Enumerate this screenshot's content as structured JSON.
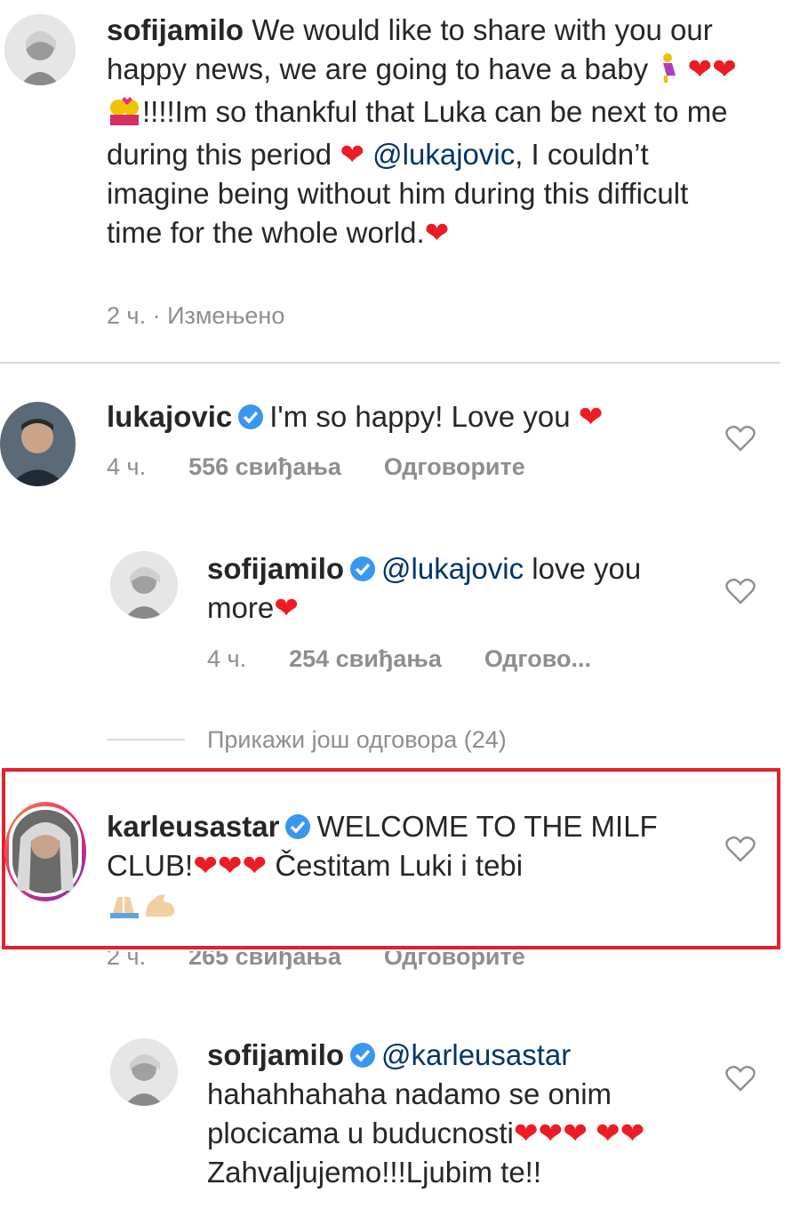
{
  "post": {
    "username": "sofijamilo",
    "caption_part1": "We would like to share with you our happy news, we are going to have a baby",
    "caption_part2": "!!!!Im so thankful that Luka can be next to me during this period",
    "caption_mention": "@lukajovic",
    "caption_part3": ", I couldn’t  imagine being without him during this difficult time for the whole world.",
    "time": "2 ч.",
    "edited": " · Измењено"
  },
  "comments": [
    {
      "username": "lukajovic",
      "text": "I'm so happy! Love you",
      "time": "4 ч.",
      "likes": "556 свиђања",
      "reply": "Одговорите"
    },
    {
      "username": "sofijamilo",
      "mention": "@lukajovic",
      "text": " love you more",
      "time": "4 ч.",
      "likes": "254 свиђања",
      "reply": "Одгово..."
    },
    {
      "username": "karleusastar",
      "text1": "WELCOME TO THE MILF CLUB!",
      "text2": " Čestitam Luki i tebi",
      "time": "2 ч.",
      "likes": "265 свиђања",
      "reply": "Одговорите"
    },
    {
      "username": "sofijamilo",
      "mention": "@karleusastar",
      "text1": " hahahhahaha nadamo se onim plocicama u buducnosti",
      "text2": "Zahvaljujemo!!!Ljubim te!!"
    }
  ],
  "more_replies": "Прикажи још одговора (24)",
  "icons": {
    "verified": "verified-badge-icon",
    "like": "heart-outline-icon",
    "heart_emoji": "red-heart-emoji"
  },
  "colors": {
    "verified": "#3897f0",
    "heart": "#ed1c24",
    "highlight": "#e0222c",
    "meta": "#8e8e8e",
    "mention": "#003569"
  }
}
